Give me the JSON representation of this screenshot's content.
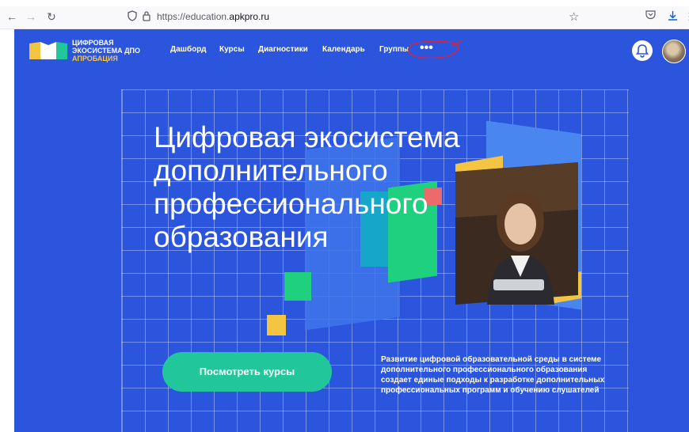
{
  "browser": {
    "url_prefix": "https://education.",
    "url_domain": "apkpro.ru"
  },
  "header": {
    "logo_line1": "ЦИФРОВАЯ",
    "logo_line2": "ЭКОСИСТЕМА ДПО",
    "logo_line3": "АПРОБАЦИЯ",
    "nav": [
      "Дашборд",
      "Курсы",
      "Диагностики",
      "Календарь",
      "Группы"
    ],
    "more_label": "•••"
  },
  "hero": {
    "title": "Цифровая экосистема дополнительного профессионального образования",
    "cta_label": "Посмотреть курсы",
    "description": "Развитие цифровой образовательной среды в системе дополнительного профессионального образования создает единые подходы к разработке дополнительных профессиональных программ и обучению слушателей"
  },
  "colors": {
    "page_bg": "#2b55dc",
    "accent_green": "#21c79a",
    "logo_yellow": "#f4c542",
    "annotation_red": "#e0203a"
  },
  "icons": [
    "back-arrow-icon",
    "forward-arrow-icon",
    "reload-icon",
    "shield-icon",
    "lock-icon",
    "star-icon",
    "pocket-icon",
    "download-icon",
    "bell-icon"
  ]
}
